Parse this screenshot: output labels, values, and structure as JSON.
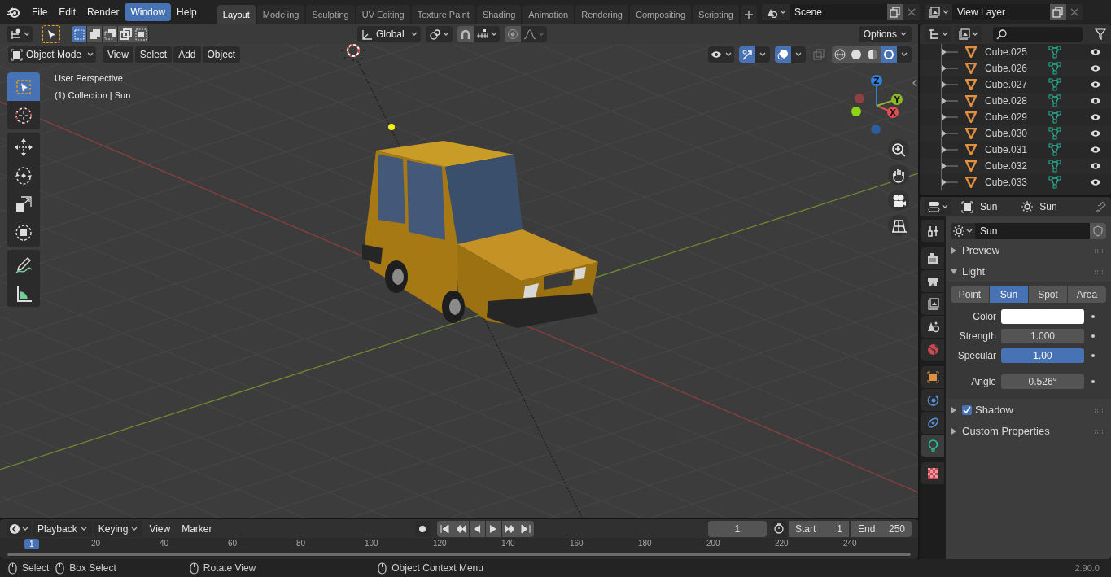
{
  "menu": [
    {
      "label": "File",
      "selected": false
    },
    {
      "label": "Edit",
      "selected": false
    },
    {
      "label": "Render",
      "selected": false
    },
    {
      "label": "Window",
      "selected": true
    },
    {
      "label": "Help",
      "selected": false
    }
  ],
  "workspaces": [
    {
      "label": "Layout",
      "selected": true
    },
    {
      "label": "Modeling",
      "selected": false
    },
    {
      "label": "Sculpting",
      "selected": false
    },
    {
      "label": "UV Editing",
      "selected": false
    },
    {
      "label": "Texture Paint",
      "selected": false
    },
    {
      "label": "Shading",
      "selected": false
    },
    {
      "label": "Animation",
      "selected": false
    },
    {
      "label": "Rendering",
      "selected": false
    },
    {
      "label": "Compositing",
      "selected": false
    },
    {
      "label": "Scripting",
      "selected": false
    }
  ],
  "scene": "Scene",
  "view_layer": "View Layer",
  "tool_header": {
    "orientation": "Global",
    "options": "Options"
  },
  "viewport": {
    "mode": "Object Mode",
    "menus": [
      "View",
      "Select",
      "Add",
      "Object"
    ],
    "info": [
      "User Perspective",
      "(1) Collection | Sun"
    ],
    "tools": [
      {
        "kind": "select",
        "selected": true
      },
      {
        "kind": "cursor",
        "selected": false
      },
      {
        "kind": "move",
        "selected": false
      },
      {
        "kind": "rotate",
        "selected": false
      },
      {
        "kind": "scale",
        "selected": false
      },
      {
        "kind": "transform",
        "selected": false
      },
      {
        "kind": "annotate",
        "selected": false
      },
      {
        "kind": "measure",
        "selected": false
      }
    ],
    "shading": [
      {
        "kind": "wireframe",
        "selected": false
      },
      {
        "kind": "solid",
        "selected": false
      },
      {
        "kind": "material",
        "selected": false
      },
      {
        "kind": "rendered",
        "selected": true
      }
    ],
    "gizmo_axes": [
      "X",
      "Y",
      "Z"
    ]
  },
  "outliner": {
    "items": [
      "Cube.025",
      "Cube.026",
      "Cube.027",
      "Cube.028",
      "Cube.029",
      "Cube.030",
      "Cube.031",
      "Cube.032",
      "Cube.033"
    ]
  },
  "properties": {
    "path": [
      "Sun",
      "Sun"
    ],
    "datablock": "Sun",
    "tabs": [
      {
        "kind": "tool",
        "selected": false
      },
      {
        "kind": "render",
        "selected": false
      },
      {
        "kind": "output",
        "selected": false
      },
      {
        "kind": "view_layer",
        "selected": false
      },
      {
        "kind": "scene",
        "selected": false
      },
      {
        "kind": "world",
        "selected": false
      },
      {
        "kind": "object",
        "selected": false
      },
      {
        "kind": "physics",
        "selected": false
      },
      {
        "kind": "constraints",
        "selected": false
      },
      {
        "kind": "data",
        "selected": true
      },
      {
        "kind": "texture",
        "selected": false
      }
    ],
    "panels": [
      {
        "kind": "plain",
        "label": "Preview",
        "expanded": false
      },
      {
        "kind": "plain",
        "label": "Light",
        "expanded": true,
        "light_types": [
          {
            "label": "Point",
            "selected": false
          },
          {
            "label": "Sun",
            "selected": true
          },
          {
            "label": "Spot",
            "selected": false
          },
          {
            "label": "Area",
            "selected": false
          }
        ],
        "fields": [
          {
            "kind": "color",
            "label": "Color",
            "color": "#ffffff"
          },
          {
            "kind": "number",
            "label": "Strength",
            "value": "1.000"
          },
          {
            "kind": "slider",
            "label": "Specular",
            "value": "1.00",
            "level": 1
          },
          {
            "kind": "number",
            "label": "Angle",
            "value": "0.526°"
          }
        ]
      },
      {
        "kind": "toggle",
        "label": "Shadow",
        "expanded": false,
        "checked": true
      },
      {
        "kind": "plain",
        "label": "Custom Properties",
        "expanded": false
      }
    ]
  },
  "timeline": {
    "menus": [
      {
        "label": "Playback",
        "dropdown": true
      },
      {
        "label": "Keying",
        "dropdown": true
      },
      {
        "label": "View",
        "dropdown": false
      },
      {
        "label": "Marker",
        "dropdown": false
      }
    ],
    "current_frame": "1",
    "start_label": "Start",
    "start": "1",
    "end_label": "End",
    "end": "250",
    "playhead": "1",
    "ruler": [
      "20",
      "40",
      "60",
      "80",
      "100",
      "120",
      "140",
      "160",
      "180",
      "200",
      "220",
      "240"
    ]
  },
  "status": {
    "items": [
      "Select",
      "Box Select",
      "Rotate View",
      "Object Context Menu"
    ],
    "version": "2.90.0"
  }
}
